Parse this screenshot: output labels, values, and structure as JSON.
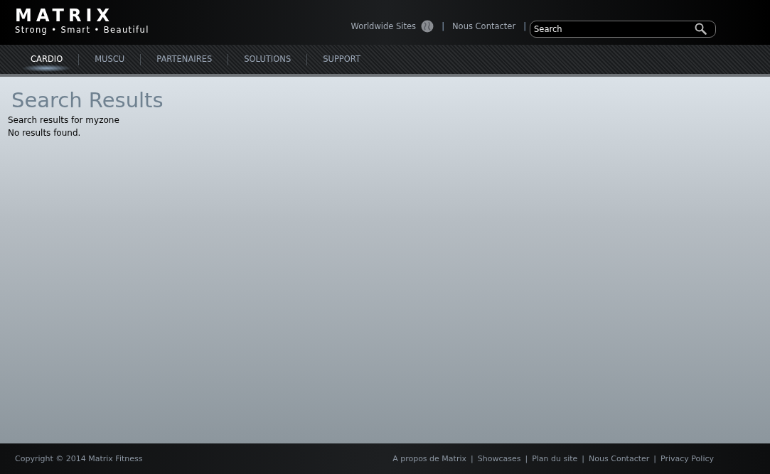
{
  "logo": {
    "name": "MATRIX",
    "tagline": "Strong • Smart • Beautiful"
  },
  "top_links": [
    {
      "kind": "link",
      "text": "Worldwide Sites",
      "globe": true
    },
    {
      "kind": "sep",
      "text": "|"
    },
    {
      "kind": "link",
      "text": "Nous Contacter",
      "globe": false
    },
    {
      "kind": "sep",
      "text": "|"
    }
  ],
  "search": {
    "placeholder": "Search"
  },
  "nav": [
    {
      "label": "CARDIO",
      "selected": true
    },
    {
      "label": "MUSCU",
      "selected": false
    },
    {
      "label": "PARTENAIRES",
      "selected": false
    },
    {
      "label": "SOLUTIONS",
      "selected": false
    },
    {
      "label": "SUPPORT",
      "selected": false
    }
  ],
  "content": {
    "title": "Search Results",
    "lines": [
      "Search results for myzone",
      "No results found."
    ]
  },
  "footer": {
    "copyright": "Copyright © 2014 Matrix Fitness",
    "separator": "|",
    "links": [
      "A propos de Matrix",
      "Showcases",
      "Plan du site",
      "Nous Contacter",
      "Privacy Policy"
    ]
  }
}
